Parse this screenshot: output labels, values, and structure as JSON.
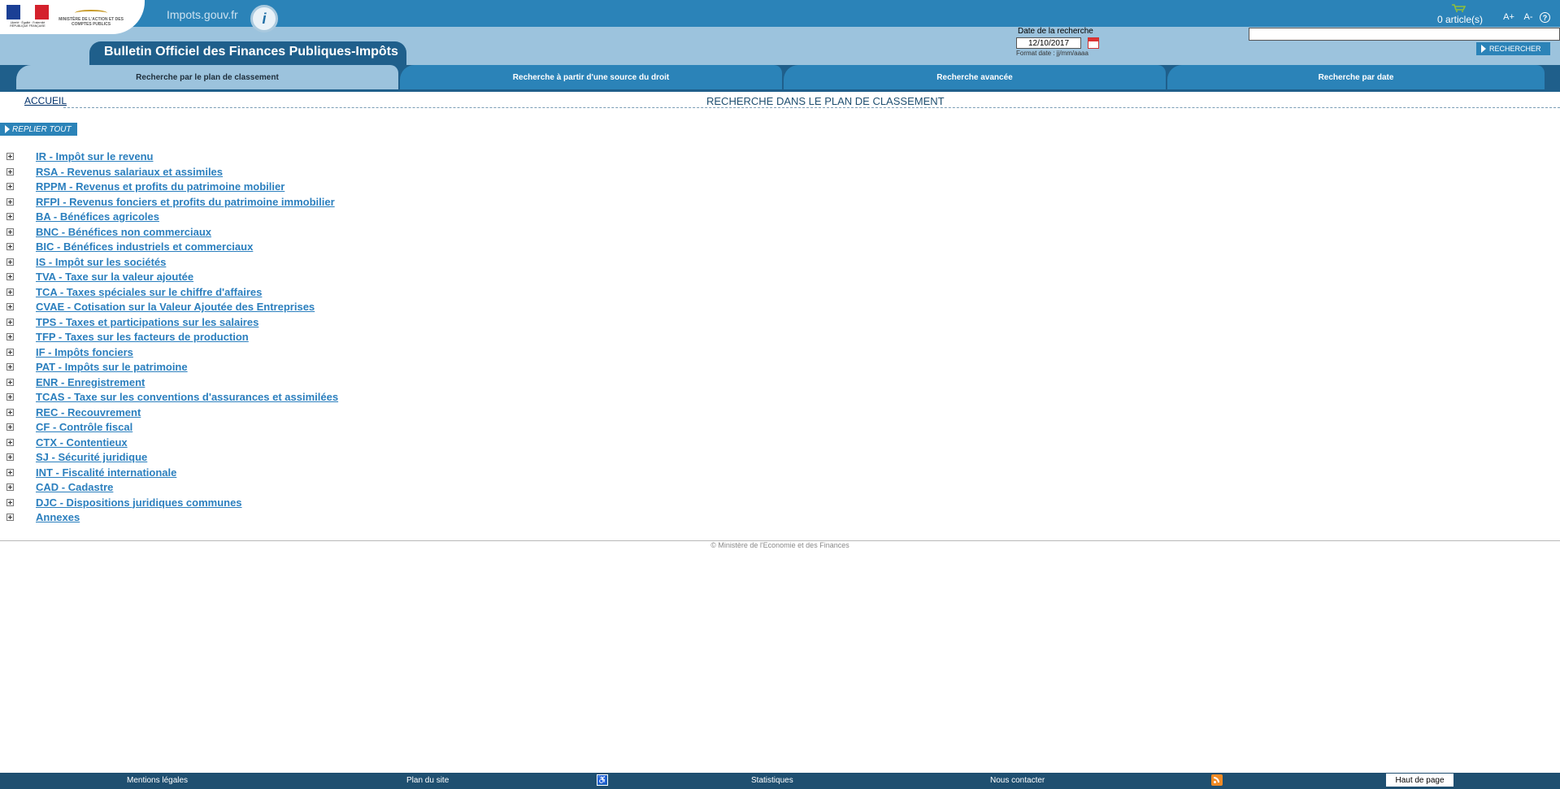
{
  "header": {
    "rf_logo_text": "Liberté · Égalité · Fraternité RÉPUBLIQUE FRANÇAISE",
    "ministry_logo_text": "MINISTÈRE DE L'ACTION ET DES COMPTES PUBLICS",
    "site_name": "Impots.gouv.fr",
    "cart_label": "0 article(s)",
    "title": "Bulletin Officiel des Finances Publiques-Impôts",
    "date_label": "Date de la recherche",
    "date_value": "12/10/2017",
    "date_hint": "Format date : jj/mm/aaaa",
    "search_placeholder": "",
    "search_button": "RECHERCHER",
    "icons": [
      "info-icon",
      "cart-icon",
      "font-increase-icon",
      "font-decrease-icon",
      "help-icon",
      "calendar-icon"
    ],
    "colors": {
      "primary_blue": "#2b83b8",
      "dark_blue": "#1f5f8b",
      "light_blue": "#9cc3dd"
    }
  },
  "nav": {
    "tabs": [
      {
        "label": "Recherche par le plan de classement",
        "active": true
      },
      {
        "label": "Recherche à partir d'une source du droit",
        "active": false
      },
      {
        "label": "Recherche avancée",
        "active": false
      },
      {
        "label": "Recherche par date",
        "active": false
      }
    ]
  },
  "main": {
    "breadcrumb_home": "ACCUEIL",
    "heading": "RECHERCHE DANS LE PLAN DE CLASSEMENT",
    "collapse_all": "REPLIER TOUT",
    "tree": [
      "IR - Impôt sur le revenu",
      "RSA - Revenus salariaux et assimiles",
      "RPPM - Revenus et profits du patrimoine mobilier",
      "RFPI - Revenus fonciers et profits du patrimoine immobilier",
      "BA - Bénéfices agricoles",
      "BNC - Bénéfices non commerciaux",
      "BIC - Bénéfices industriels et commerciaux",
      "IS - Impôt sur les sociétés",
      "TVA - Taxe sur la valeur ajoutée",
      "TCA - Taxes spéciales sur le chiffre d'affaires",
      "CVAE - Cotisation sur la Valeur Ajoutée des Entreprises",
      "TPS - Taxes et participations sur les salaires",
      "TFP - Taxes sur les facteurs de production",
      "IF - Impôts fonciers",
      "PAT - Impôts sur le patrimoine",
      "ENR - Enregistrement",
      "TCAS - Taxe sur les conventions d'assurances et assimilées",
      "REC - Recouvrement",
      "CF - Contrôle fiscal",
      "CTX - Contentieux",
      "SJ - Sécurité juridique",
      "INT - Fiscalité internationale",
      "CAD - Cadastre",
      "DJC - Dispositions juridiques communes",
      "Annexes"
    ]
  },
  "footer": {
    "copyright": "© Ministère de l'Economie et des Finances",
    "links": {
      "legal": "Mentions légales",
      "sitemap": "Plan du site",
      "stats": "Statistiques",
      "contact": "Nous contacter",
      "top": "Haut de page"
    },
    "icons": [
      "accessibility-icon",
      "rss-icon"
    ]
  }
}
